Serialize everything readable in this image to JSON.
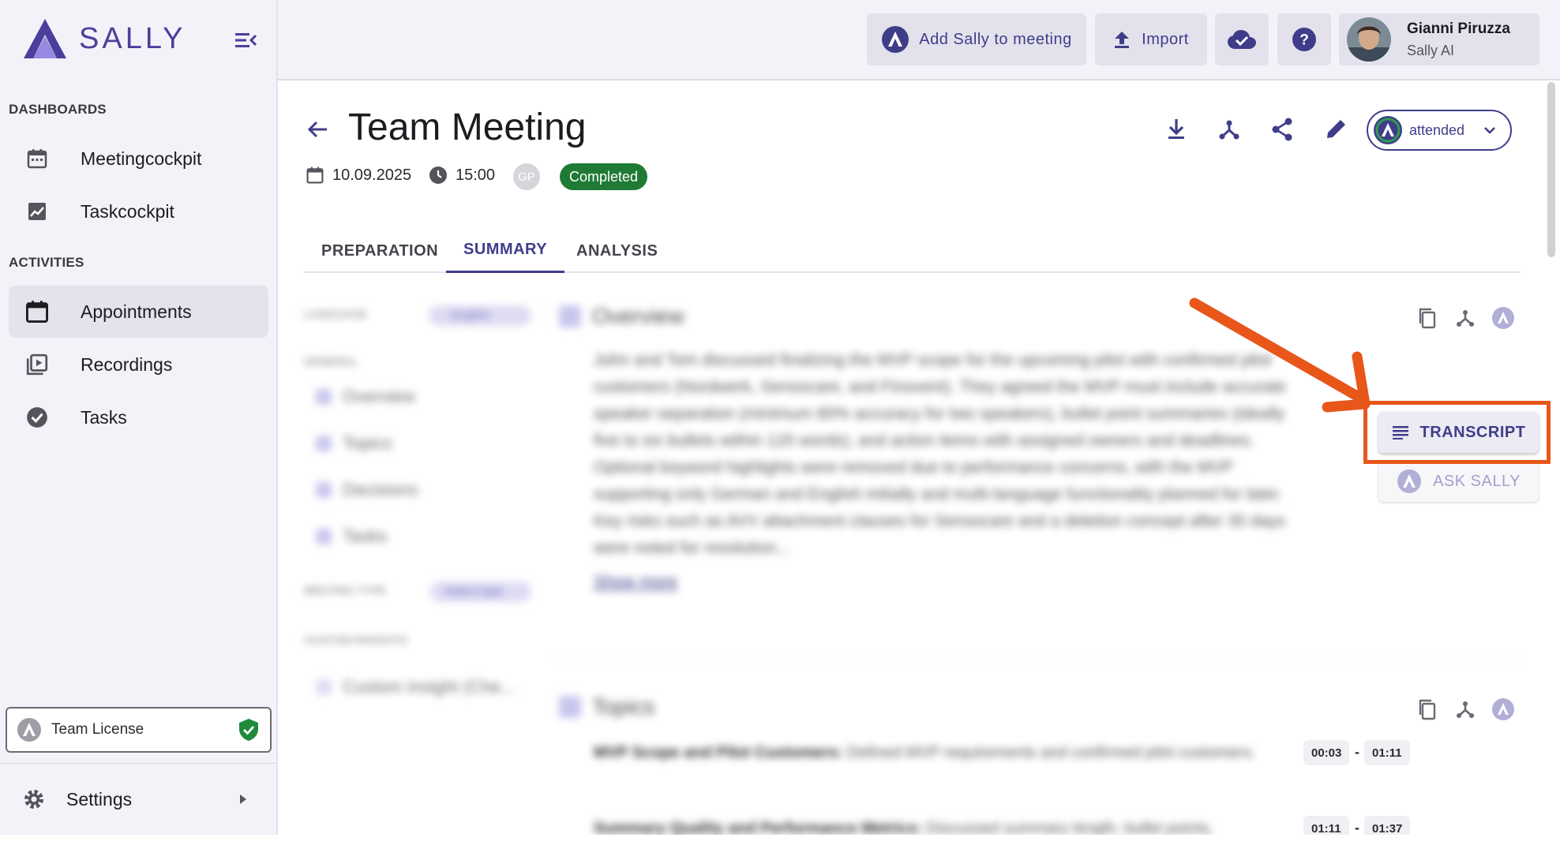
{
  "sidebar": {
    "brand": "SALLY",
    "sections": [
      {
        "label": "DASHBOARDS",
        "items": [
          {
            "label": "Meetingcockpit",
            "icon": "calendar-icon"
          },
          {
            "label": "Taskcockpit",
            "icon": "chart-icon"
          }
        ]
      },
      {
        "label": "ACTIVITIES",
        "items": [
          {
            "label": "Appointments",
            "icon": "calendar-icon",
            "active": true
          },
          {
            "label": "Recordings",
            "icon": "video-library-icon"
          },
          {
            "label": "Tasks",
            "icon": "check-circle-icon"
          }
        ]
      }
    ],
    "license": "Team License",
    "settings": "Settings"
  },
  "header": {
    "add_sally": "Add Sally to meeting",
    "import": "Import",
    "user": {
      "name": "Gianni Piruzza",
      "org": "Sally AI"
    }
  },
  "meeting": {
    "title": "Team Meeting",
    "date": "10.09.2025",
    "time": "15:00",
    "participant_initials": "GP",
    "status": "Completed",
    "attendance": "attended"
  },
  "tabs": [
    "PREPARATION",
    "SUMMARY",
    "ANALYSIS"
  ],
  "active_tab": "SUMMARY",
  "summary": {
    "overview_title": "Overview",
    "overview_text": "John and Tom discussed finalizing the MVP scope for the upcoming pilot with confirmed pilot customers (Nordwerk, Sensocare, and Finovent). They agreed the MVP must include accurate speaker separation (minimum 80% accuracy for two speakers), bullet point summaries (ideally five to six bullets within 120 words), and action items with assigned owners and deadlines. Optional keyword highlights were removed due to performance concerns, with the MVP supporting only German and English initially and multi-language functionality planned for later. Key risks such as AVV attachment clauses for Sensocare and a deletion concept after 30 days were noted for resolution...",
    "show_more": "Show more",
    "topics_title": "Topics",
    "topics": [
      {
        "title": "MVP Scope and Pilot Customers:",
        "text": "Defined MVP requirements and confirmed pilot customers.",
        "start": "00:03",
        "end": "01:11"
      },
      {
        "title": "Summary Quality and Performance Metrics:",
        "text": "Discussed summary length, bullet points,",
        "start": "01:11",
        "end": "01:37"
      }
    ],
    "side_panel": {
      "language_label": "LANGUAGE",
      "language_value": "English",
      "general_label": "GENERAL",
      "nav": [
        "Overview",
        "Topics",
        "Decisions",
        "Tasks"
      ],
      "meeting_type_label": "MEETING TYPE",
      "meeting_type_value": "Select type",
      "custom_label": "CUSTOM INSIGHTS",
      "custom_item": "Custom Insight (Che..."
    },
    "transcript_button": "TRANSCRIPT",
    "ask_button": "ASK SALLY"
  },
  "colors": {
    "accent": "#3f3d8a",
    "status_completed": "#1f7a35",
    "annotation": "#e8561a",
    "license_shield": "#1f8a3a"
  }
}
